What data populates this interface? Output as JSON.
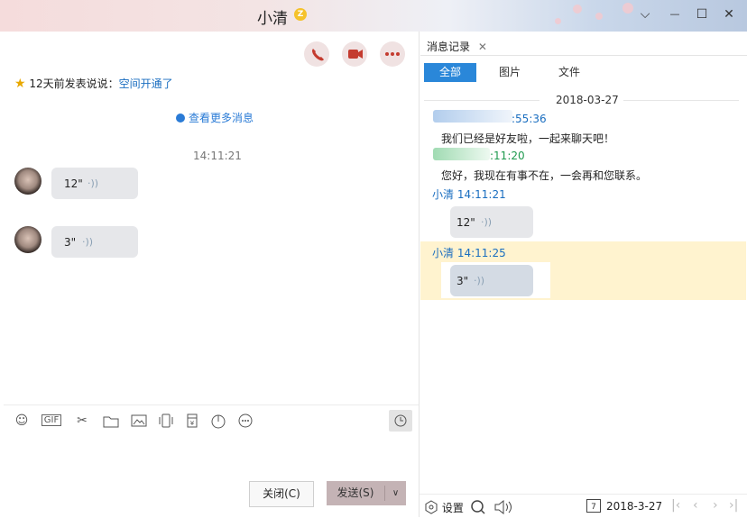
{
  "window": {
    "title": "小清",
    "buttons": {
      "dropdown": "⌵",
      "minimize": "—",
      "maximize": "☐",
      "close": "✕"
    }
  },
  "chat": {
    "header_actions": [
      {
        "name": "voice-call-icon",
        "color": "#c43b2f"
      },
      {
        "name": "video-call-icon",
        "color": "#c43b2f"
      },
      {
        "name": "more-icon",
        "color": "#c43b2f"
      }
    ],
    "system_notice": {
      "prefix": "12天前发表说说：",
      "link": "空间开通了"
    },
    "more_messages": "查看更多消息",
    "timestamp": "14:11:21",
    "messages": [
      {
        "duration": "12\""
      },
      {
        "duration": "3\""
      }
    ],
    "toolbar": [
      "emoji-icon",
      "gif-icon",
      "screenshot-icon",
      "folder-icon",
      "image-icon",
      "shake-icon",
      "red-packet-icon",
      "music-icon",
      "more-tools-icon"
    ],
    "close_button": "关闭(C)",
    "send_button": "发送(S)"
  },
  "history": {
    "tab_label": "消息记录",
    "filters": [
      "全部",
      "图片",
      "文件"
    ],
    "active_filter": "全部",
    "date": "2018-03-27",
    "entries": [
      {
        "time_partial": ":55:36",
        "text": "我们已经是好友啦，一起来聊天吧！"
      },
      {
        "time_partial": ":11:20",
        "text": "您好，我现在有事不在，一会再和您联系。"
      },
      {
        "sender": "小清 14:11:21",
        "duration": "12\""
      },
      {
        "sender": "小清 14:11:25",
        "duration": "3\""
      }
    ],
    "footer": {
      "settings": "设置",
      "date": "2018-3-27",
      "date_icon_text": "7"
    }
  },
  "colors": {
    "accent": "#2a87d9",
    "highlight": "#fff3cf",
    "send": "#c4b3b5"
  }
}
